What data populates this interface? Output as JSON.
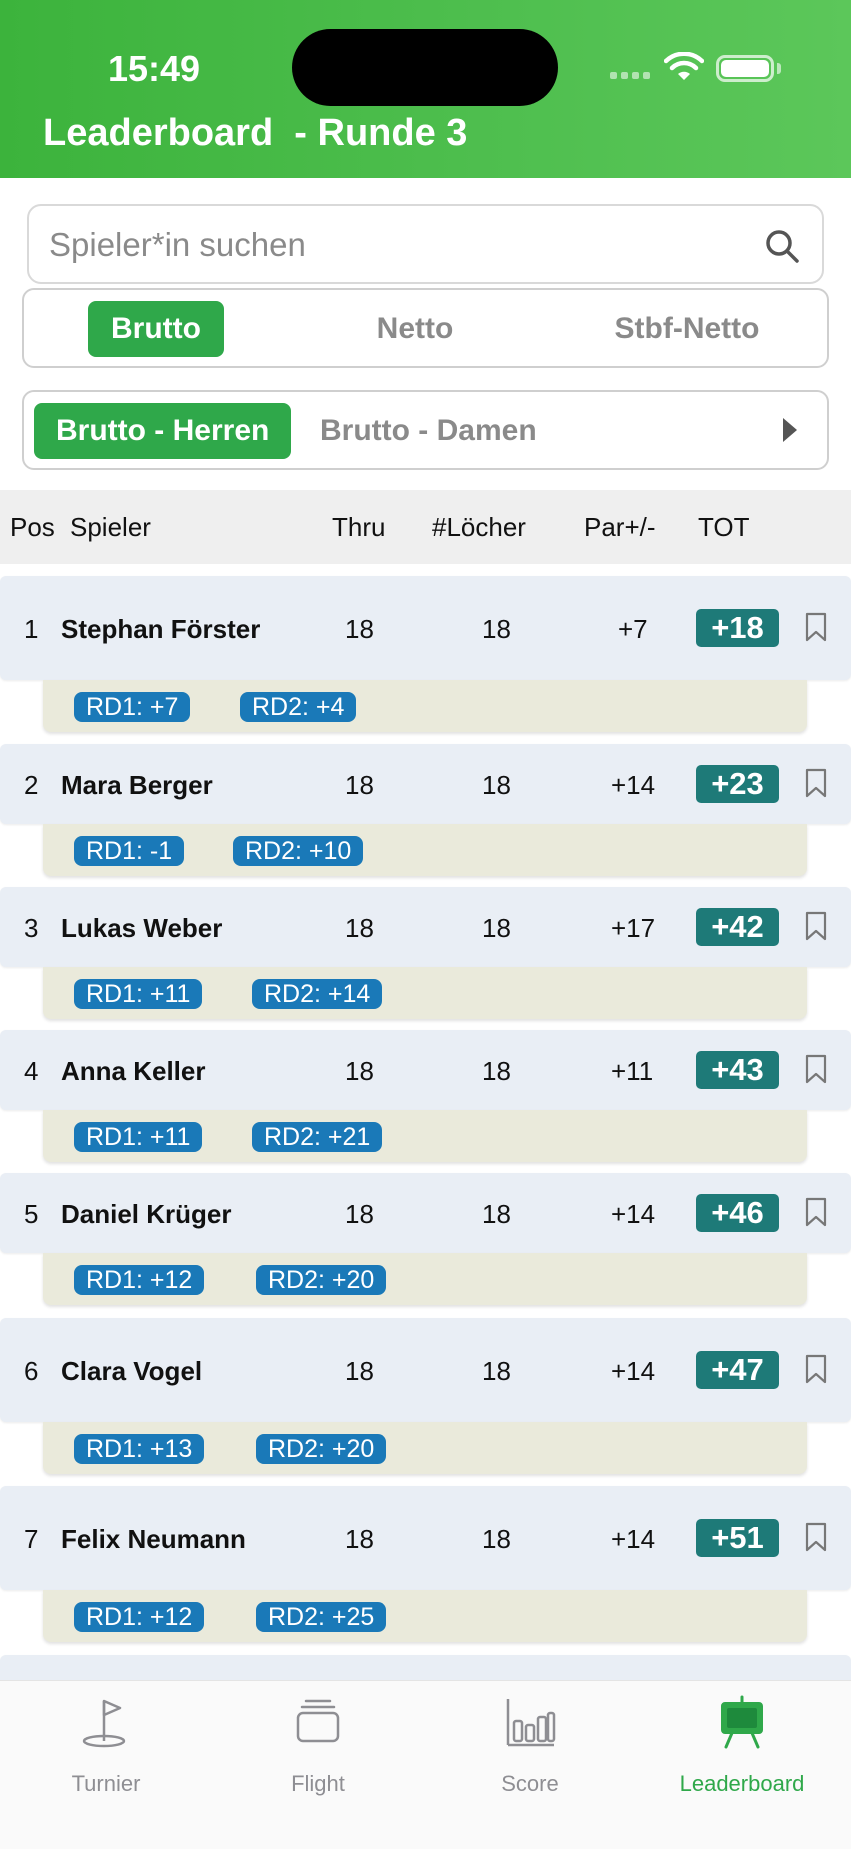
{
  "status": {
    "time": "15:49"
  },
  "header": {
    "title": "Leaderboard  - Runde 3"
  },
  "search": {
    "placeholder": "Spieler*in suchen"
  },
  "modes": [
    "Brutto",
    "Netto",
    "Stbf-Netto"
  ],
  "active_mode": "Brutto",
  "categories": [
    "Brutto - Herren",
    "Brutto - Damen"
  ],
  "active_category": "Brutto - Herren",
  "table": {
    "headers": {
      "pos": "Pos",
      "player": "Spieler",
      "thru": "Thru",
      "holes": "#Löcher",
      "par": "Par+/-",
      "tot": "TOT"
    },
    "rows": [
      {
        "pos": "1",
        "name": "Stephan Förster",
        "thru": "18",
        "holes": "18",
        "par": "+7",
        "tot": "+18",
        "rd1": "RD1: +7",
        "rd2": "RD2: +4"
      },
      {
        "pos": "2",
        "name": "Mara Berger",
        "thru": "18",
        "holes": "18",
        "par": "+14",
        "tot": "+23",
        "rd1": "RD1: -1",
        "rd2": "RD2: +10"
      },
      {
        "pos": "3",
        "name": "Lukas Weber",
        "thru": "18",
        "holes": "18",
        "par": "+17",
        "tot": "+42",
        "rd1": "RD1: +11",
        "rd2": "RD2: +14"
      },
      {
        "pos": "4",
        "name": "Anna Keller",
        "thru": "18",
        "holes": "18",
        "par": "+11",
        "tot": "+43",
        "rd1": "RD1: +11",
        "rd2": "RD2: +21"
      },
      {
        "pos": "5",
        "name": "Daniel Krüger",
        "thru": "18",
        "holes": "18",
        "par": "+14",
        "tot": "+46",
        "rd1": "RD1: +12",
        "rd2": "RD2: +20"
      },
      {
        "pos": "6",
        "name": "Clara Vogel",
        "thru": "18",
        "holes": "18",
        "par": "+14",
        "tot": "+47",
        "rd1": "RD1: +13",
        "rd2": "RD2: +20"
      },
      {
        "pos": "7",
        "name": "Felix Neumann",
        "thru": "18",
        "holes": "18",
        "par": "+14",
        "tot": "+51",
        "rd1": "RD1: +12",
        "rd2": "RD2: +25"
      }
    ]
  },
  "tabbar": {
    "items": [
      {
        "label": "Turnier",
        "icon": "flag-icon"
      },
      {
        "label": "Flight",
        "icon": "stack-icon"
      },
      {
        "label": "Score",
        "icon": "bar-chart-icon"
      },
      {
        "label": "Leaderboard",
        "icon": "easel-icon"
      }
    ],
    "active": "Leaderboard"
  },
  "colors": {
    "brand_green": "#2fa84a",
    "tot_badge": "#1e7a78",
    "round_chip": "#1a79b8"
  }
}
